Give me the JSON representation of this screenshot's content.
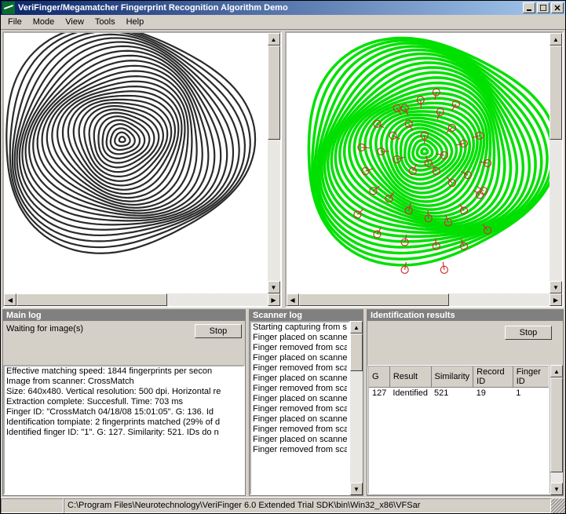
{
  "window": {
    "title": "VeriFinger/Megamatcher Fingerprint Recognition Algorithm Demo"
  },
  "menu": {
    "file": "File",
    "mode": "Mode",
    "view": "View",
    "tools": "Tools",
    "help": "Help"
  },
  "main_log": {
    "title": "Main log",
    "waiting": "Waiting for image(s)",
    "stop_label": "Stop",
    "lines": [
      "Effective matching speed: 1844 fingerprints per secon",
      "",
      "Image from scanner: CrossMatch",
      "Size: 640x480. Vertical resolution: 500 dpi. Horizontal re",
      "Extraction complete: Succesfull. Time: 703 ms",
      "Finger ID: \"CrossMatch 04/18/08 15:01:05\". G: 136. Id",
      "Identification tompiate: 2 fingerprints matched (29% of d",
      "Identified finger ID: \"1\". G: 127. Similarity: 521. IDs do n"
    ]
  },
  "scanner_log": {
    "title": "Scanner log",
    "lines": [
      "Starting capturing from sc",
      "Finger placed on scanne",
      "Finger removed from scan",
      "Finger placed on scanne",
      "Finger removed from scan",
      "Finger placed on scanne",
      "Finger removed from scan",
      "Finger placed on scanne",
      "Finger removed from scan",
      "Finger placed on scanne",
      "Finger removed from scan",
      "Finger placed on scanne",
      "Finger removed from scan"
    ]
  },
  "ident": {
    "title": "Identification results",
    "stop_label": "Stop",
    "columns": {
      "g": "G",
      "result": "Result",
      "similarity": "Similarity",
      "record_id": "Record ID",
      "finger_id": "Finger ID"
    },
    "row": {
      "g": "127",
      "result": "Identified",
      "similarity": "521",
      "record_id": "19",
      "finger_id": "1"
    }
  },
  "statusbar": {
    "path": "C:\\Program Files\\Neurotechnology\\VeriFinger 6.0 Extended Trial SDK\\bin\\Win32_x86\\VFSar"
  }
}
